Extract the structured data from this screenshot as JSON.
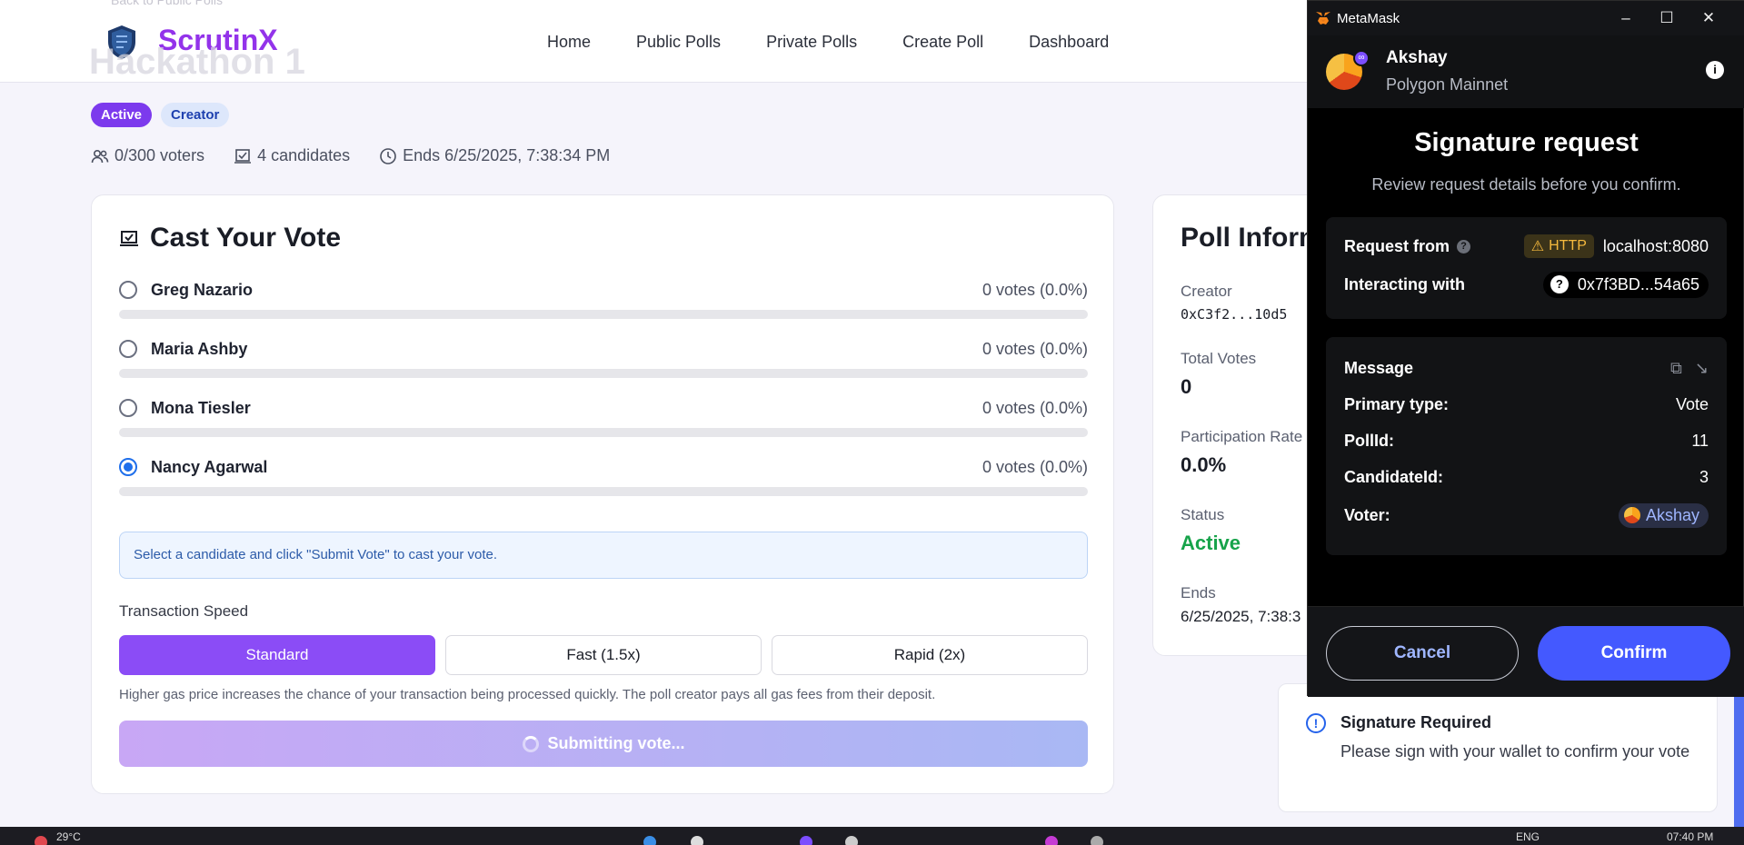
{
  "nav": {
    "brand": "ScrutinX",
    "links": [
      "Home",
      "Public Polls",
      "Private Polls",
      "Create Poll",
      "Dashboard"
    ]
  },
  "poll": {
    "title_partial": "Hackathon 1",
    "back_link": "Back to Public Polls",
    "badges": {
      "status": "Active",
      "role": "Creator"
    },
    "voters": "0/300 voters",
    "candidates_count": "4 candidates",
    "ends": "Ends 6/25/2025, 7:38:34 PM"
  },
  "vote": {
    "heading": "Cast Your Vote",
    "candidates": [
      {
        "name": "Greg Nazario",
        "votes": "0 votes (0.0%)",
        "share": 0.0,
        "selected": false
      },
      {
        "name": "Maria Ashby",
        "votes": "0 votes (0.0%)",
        "share": 0.0,
        "selected": false
      },
      {
        "name": "Mona Tiesler",
        "votes": "0 votes (0.0%)",
        "share": 0.0,
        "selected": false
      },
      {
        "name": "Nancy Agarwal",
        "votes": "0 votes (0.0%)",
        "share": 0.0,
        "selected": true
      }
    ],
    "hint": "Select a candidate and click \"Submit Vote\" to cast your vote.",
    "speed_label": "Transaction Speed",
    "speeds": [
      "Standard",
      "Fast (1.5x)",
      "Rapid (2x)"
    ],
    "selected_speed": "Standard",
    "speed_note": "Higher gas price increases the chance of your transaction being processed quickly. The poll creator pays all gas fees from their deposit.",
    "submit_label": "Submitting vote..."
  },
  "poll_info": {
    "heading": "Poll Inform",
    "creator_label": "Creator",
    "creator_value": "0xC3f2...10d5",
    "total_label": "Total Votes",
    "total_value": "0",
    "rate_label": "Participation Rate",
    "rate_value": "0.0%",
    "status_label": "Status",
    "status_value": "Active",
    "ends_label": "Ends",
    "ends_value": "6/25/2025, 7:38:3"
  },
  "toast": {
    "title": "Signature Required",
    "desc": "Please sign with your wallet to confirm your vote"
  },
  "metamask": {
    "window_title": "MetaMask",
    "account": "Akshay",
    "network": "Polygon Mainnet",
    "heading": "Signature request",
    "subheading": "Review request details before you confirm.",
    "request_from_label": "Request from",
    "http_badge": "HTTP",
    "origin": "localhost:8080",
    "interacting_label": "Interacting with",
    "contract": "0x7f3BD...54a65",
    "message_label": "Message",
    "primary_type_label": "Primary type:",
    "primary_type": "Vote",
    "poll_id_label": "PollId:",
    "poll_id": "11",
    "candidate_id_label": "CandidateId:",
    "candidate_id": "3",
    "voter_label": "Voter:",
    "voter": "Akshay",
    "cancel": "Cancel",
    "confirm": "Confirm"
  },
  "taskbar": {
    "temperature": "29°C",
    "language": "ENG",
    "time": "07:40 PM"
  },
  "colors": {
    "brand": "#9333ea",
    "accent": "#8b4cf6",
    "status_green": "#16a34a",
    "mm_confirm": "#4459ff"
  }
}
